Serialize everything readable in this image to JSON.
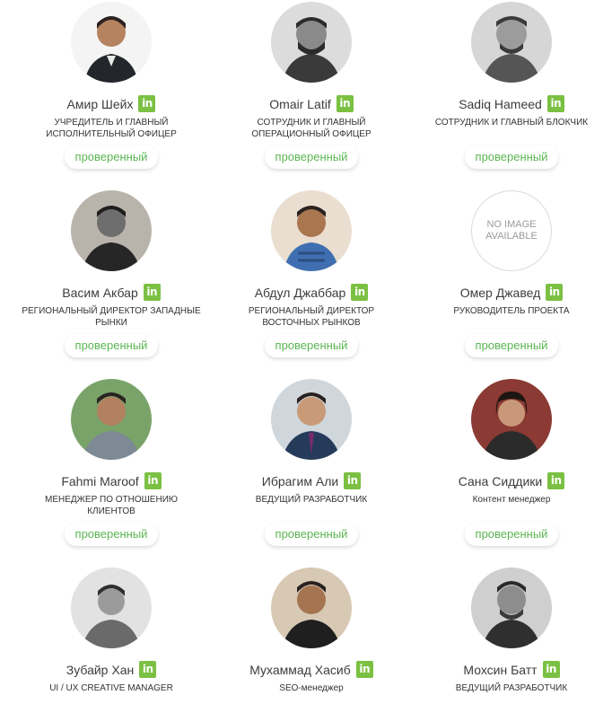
{
  "verified_label": "проверенный",
  "brand_color": "#7bc043",
  "badge_text_color": "#5ab552",
  "linkedin_glyph": "in",
  "no_image_text": "NO IMAGE\nAVAILABLE",
  "team": [
    {
      "name": "Амир Шейх",
      "role": "УЧРЕДИТЕЛЬ И ГЛАВНЫЙ ИСПОЛНИТЕЛЬНЫЙ ОФИЦЕР",
      "photo": "portrait"
    },
    {
      "name": "Omair Latif",
      "role": "СОТРУДНИК И ГЛАВНЫЙ ОПЕРАЦИОННЫЙ ОФИЦЕР",
      "photo": "portrait"
    },
    {
      "name": "Sadiq Hameed",
      "role": "СОТРУДНИК И ГЛАВНЫЙ БЛОКЧИК",
      "photo": "portrait"
    },
    {
      "name": "Васим Акбар",
      "role": "РЕГИОНАЛЬНЫЙ ДИРЕКТОР ЗАПАДНЫЕ РЫНКИ",
      "photo": "portrait"
    },
    {
      "name": "Абдул Джаббар",
      "role": "РЕГИОНАЛЬНЫЙ ДИРЕКТОР ВОСТОЧНЫХ РЫНКОВ",
      "photo": "portrait"
    },
    {
      "name": "Омер Джавед",
      "role": "РУКОВОДИТЕЛЬ ПРОЕКТА",
      "photo": "none"
    },
    {
      "name": "Fahmi Maroof",
      "role": "МЕНЕДЖЕР ПО ОТНОШЕНИЮ КЛИЕНТОВ",
      "photo": "portrait"
    },
    {
      "name": "Ибрагим Али",
      "role": "ВЕДУЩИЙ РАЗРАБОТЧИК",
      "photo": "portrait"
    },
    {
      "name": "Сана Сиддики",
      "role": "Контент менеджер",
      "photo": "portrait"
    },
    {
      "name": "Зубайр Хан",
      "role": "UI / UX CREATIVE MANAGER",
      "photo": "portrait"
    },
    {
      "name": "Мухаммад Хасиб",
      "role": "SEO-менеджер",
      "photo": "portrait"
    },
    {
      "name": "Мохсин Батт",
      "role": "ВЕДУЩИЙ РАЗРАБОТЧИК",
      "photo": "portrait"
    }
  ]
}
